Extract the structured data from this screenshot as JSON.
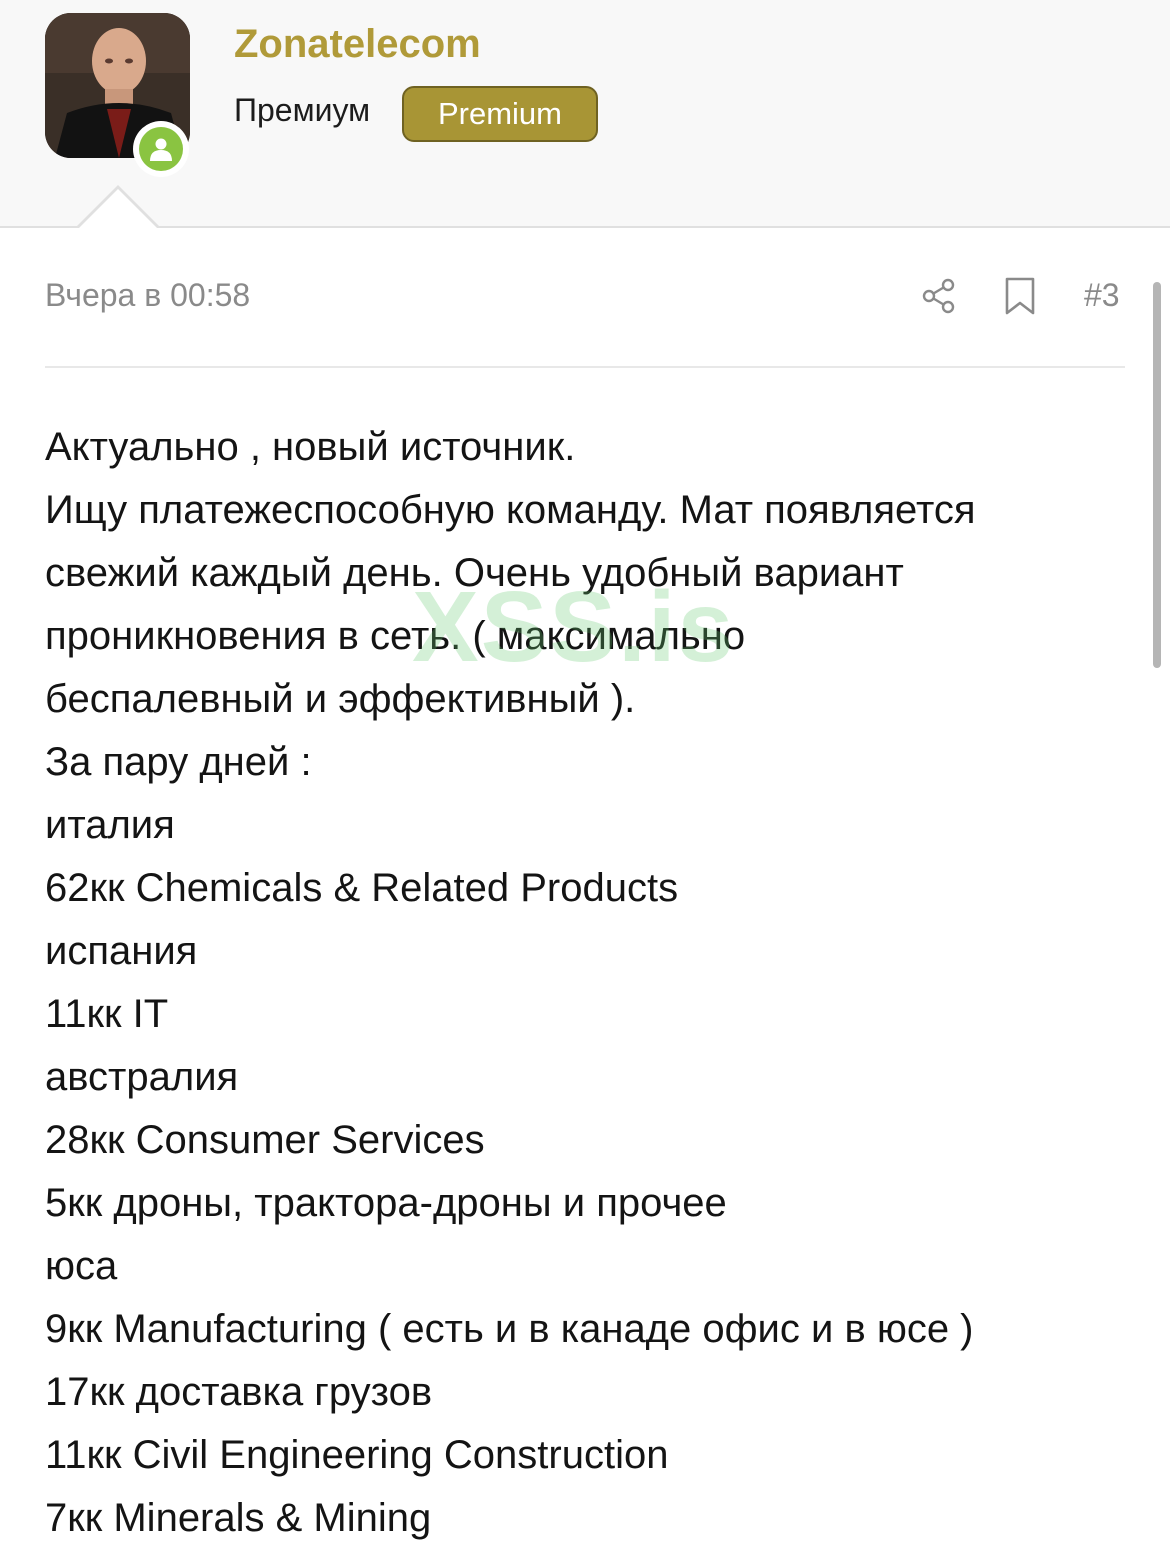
{
  "user": {
    "name": "Zonatelecom",
    "role": "Премиум",
    "badge": "Premium",
    "accent_color": "#b09a39",
    "badge_color": "#a89535",
    "online_color": "#8ac441"
  },
  "post": {
    "date": "Вчера в 00:58",
    "number": "#3",
    "share_icon": "share-icon",
    "bookmark_icon": "bookmark-icon",
    "lines": [
      "Актуально , новый источник.",
      "Ищу платежеспособную команду. Мат появляется",
      "свежий каждый день. Очень удобный вариант",
      "проникновения в сеть. ( максимально",
      "беспалевный и эффективный ).",
      "За пару дней :",
      "италия",
      "62кк Chemicals & Related Products",
      "испания",
      "11кк IT",
      "австралия",
      "28кк Consumer Services",
      "5кк дроны, трактора-дроны и прочее",
      "юса",
      "9кк Manufacturing ( есть и в канаде офис и в юсе )",
      "17кк доставка грузов",
      "11кк Civil Engineering Construction",
      "7кк Minerals & Mining"
    ]
  },
  "watermark": "XSS.is"
}
